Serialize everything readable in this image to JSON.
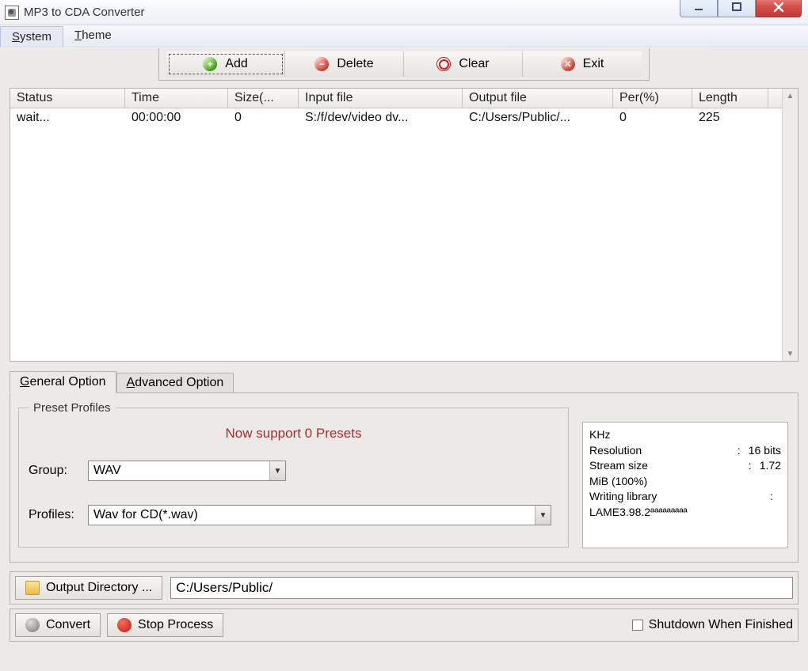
{
  "window": {
    "title": "MP3 to CDA Converter"
  },
  "menu": {
    "system": "System",
    "theme": "Theme"
  },
  "toolbar": {
    "add": "Add",
    "delete": "Delete",
    "clear": "Clear",
    "exit": "Exit"
  },
  "list": {
    "headers": {
      "status": "Status",
      "time": "Time",
      "size": "Size(...",
      "input": "Input file",
      "output": "Output file",
      "per": "Per(%)",
      "length": "Length"
    },
    "rows": [
      {
        "status": "wait...",
        "time": "00:00:00",
        "size": "0",
        "input": "S:/f/dev/video dv...",
        "output": "C:/Users/Public/...",
        "per": "0",
        "length": "225"
      }
    ]
  },
  "tabs": {
    "general": "General Option",
    "advanced": "Advanced Option"
  },
  "preset": {
    "legend": "Preset Profiles",
    "support": "Now support 0 Presets",
    "group_label": "Group:",
    "group_value": "WAV",
    "profiles_label": "Profiles:",
    "profiles_value": "Wav for CD(*.wav)"
  },
  "info": {
    "l1": "KHz",
    "l2k": "Resolution",
    "l2v": "16 bits",
    "l3k": "Stream size",
    "l3v": "1.72",
    "l4": "MiB (100%)",
    "l5k": "Writing library",
    "l5v": "",
    "l6": "LAME3.98.2ªªªªªªªªª"
  },
  "output": {
    "button": "Output Directory ...",
    "path": "C:/Users/Public/"
  },
  "actions": {
    "convert": "Convert",
    "stop": "Stop Process",
    "shutdown": "Shutdown When Finished"
  }
}
